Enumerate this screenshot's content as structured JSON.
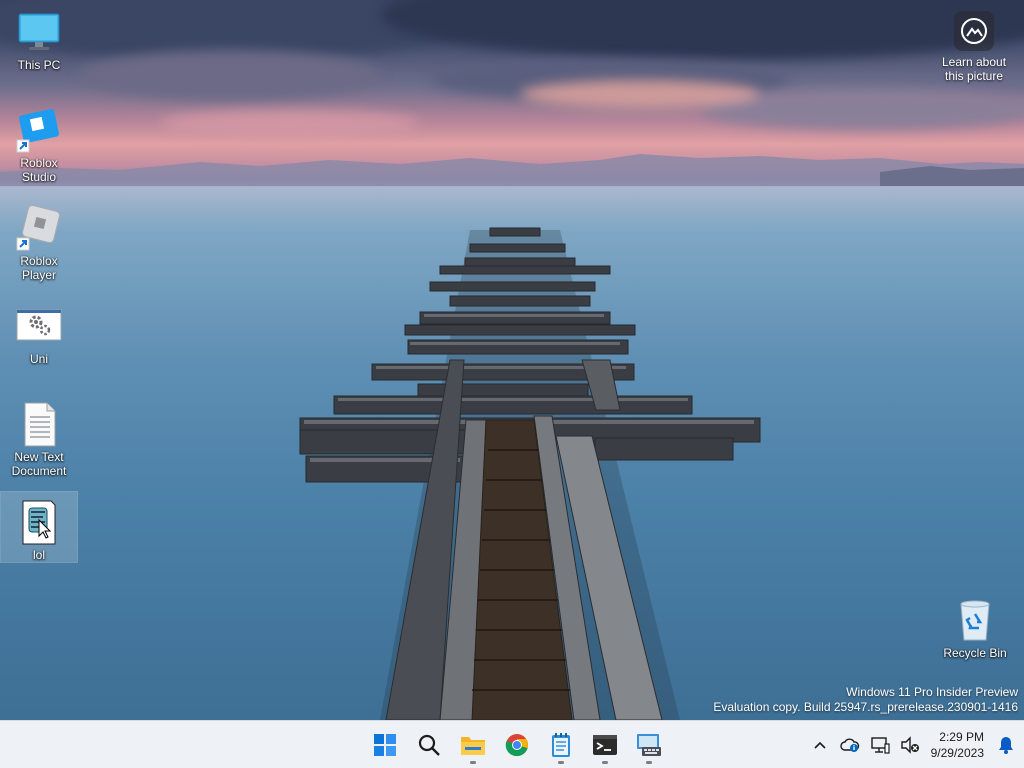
{
  "desktop": {
    "icons": [
      {
        "label": "This PC"
      },
      {
        "label": "Roblox Studio"
      },
      {
        "label": "Roblox Player"
      },
      {
        "label": "Uni"
      },
      {
        "label": "New Text Document"
      },
      {
        "label": "lol"
      }
    ],
    "recycle_bin": {
      "label": "Recycle Bin"
    },
    "learn_picture": {
      "label": "Learn about this picture"
    }
  },
  "watermark": {
    "line1": "Windows 11 Pro Insider Preview",
    "line2": "Evaluation copy. Build 25947.rs_prerelease.230901-1416"
  },
  "taskbar": {
    "apps": [
      {
        "name": "start-icon"
      },
      {
        "name": "search-icon"
      },
      {
        "name": "file-explorer-icon",
        "running": true
      },
      {
        "name": "chrome-icon"
      },
      {
        "name": "notepad-icon",
        "running": true
      },
      {
        "name": "terminal-icon",
        "running": true
      },
      {
        "name": "remote-keyboard-icon",
        "running": true
      }
    ],
    "tray": {
      "time": "2:29 PM",
      "date": "9/29/2023"
    }
  },
  "colors": {
    "taskbar_bg": "#eef1f6",
    "windows_blue": "#0078d4",
    "notification_bell": "#0a5bc4"
  }
}
